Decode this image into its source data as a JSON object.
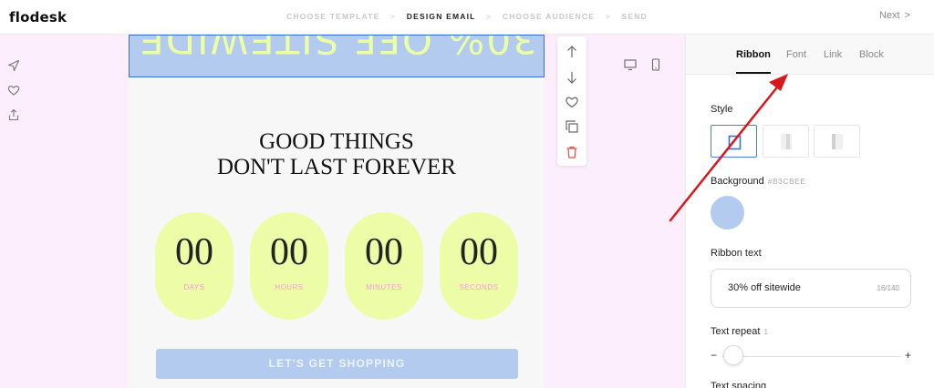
{
  "app": {
    "logo": "flodesk"
  },
  "steps": [
    {
      "label": "CHOOSE TEMPLATE",
      "active": false
    },
    {
      "label": "DESIGN EMAIL",
      "active": true
    },
    {
      "label": "CHOOSE AUDIENCE",
      "active": false
    },
    {
      "label": "SEND",
      "active": false
    }
  ],
  "step_sep": ">",
  "next": {
    "label": "Next",
    "icon": ">"
  },
  "left_tools": [
    "send-icon",
    "heart-icon",
    "share-icon"
  ],
  "block_tools": [
    "arrow-up-icon",
    "arrow-down-icon",
    "heart-icon",
    "duplicate-icon",
    "trash-icon"
  ],
  "device_icons": [
    "desktop-icon",
    "mobile-icon"
  ],
  "email": {
    "ribbon_text": "30% OFF SITEWIDE",
    "headline_line1": "GOOD THINGS",
    "headline_line2": "DON'T LAST FOREVER",
    "countdown": [
      {
        "value": "00",
        "label": "DAYS"
      },
      {
        "value": "00",
        "label": "HOURS"
      },
      {
        "value": "00",
        "label": "MINUTES"
      },
      {
        "value": "00",
        "label": "SECONDS"
      }
    ],
    "cta": "LET'S GET SHOPPING"
  },
  "panel": {
    "tabs": [
      {
        "label": "Ribbon",
        "active": true
      },
      {
        "label": "Font",
        "active": false
      },
      {
        "label": "Link",
        "active": false
      },
      {
        "label": "Block",
        "active": false
      }
    ],
    "style_label": "Style",
    "background_label": "Background",
    "background_hex": "#B3CBEE",
    "ribbon_text_label": "Ribbon text",
    "ribbon_text_value": "30% off sitewide",
    "ribbon_text_count": "16/140",
    "text_repeat_label": "Text repeat",
    "text_repeat_value": "1",
    "text_repeat_min": "−",
    "text_repeat_max": "+",
    "text_spacing_label": "Text spacing"
  },
  "colors": {
    "ribbon": "#B3CBEE",
    "ribbon_text": "#EAFFA6",
    "countdown_bg": "#EDFDA7",
    "countdown_label": "#F29FD0",
    "page_bg": "#FDEEFE",
    "annotation_arrow": "#D7191C"
  }
}
